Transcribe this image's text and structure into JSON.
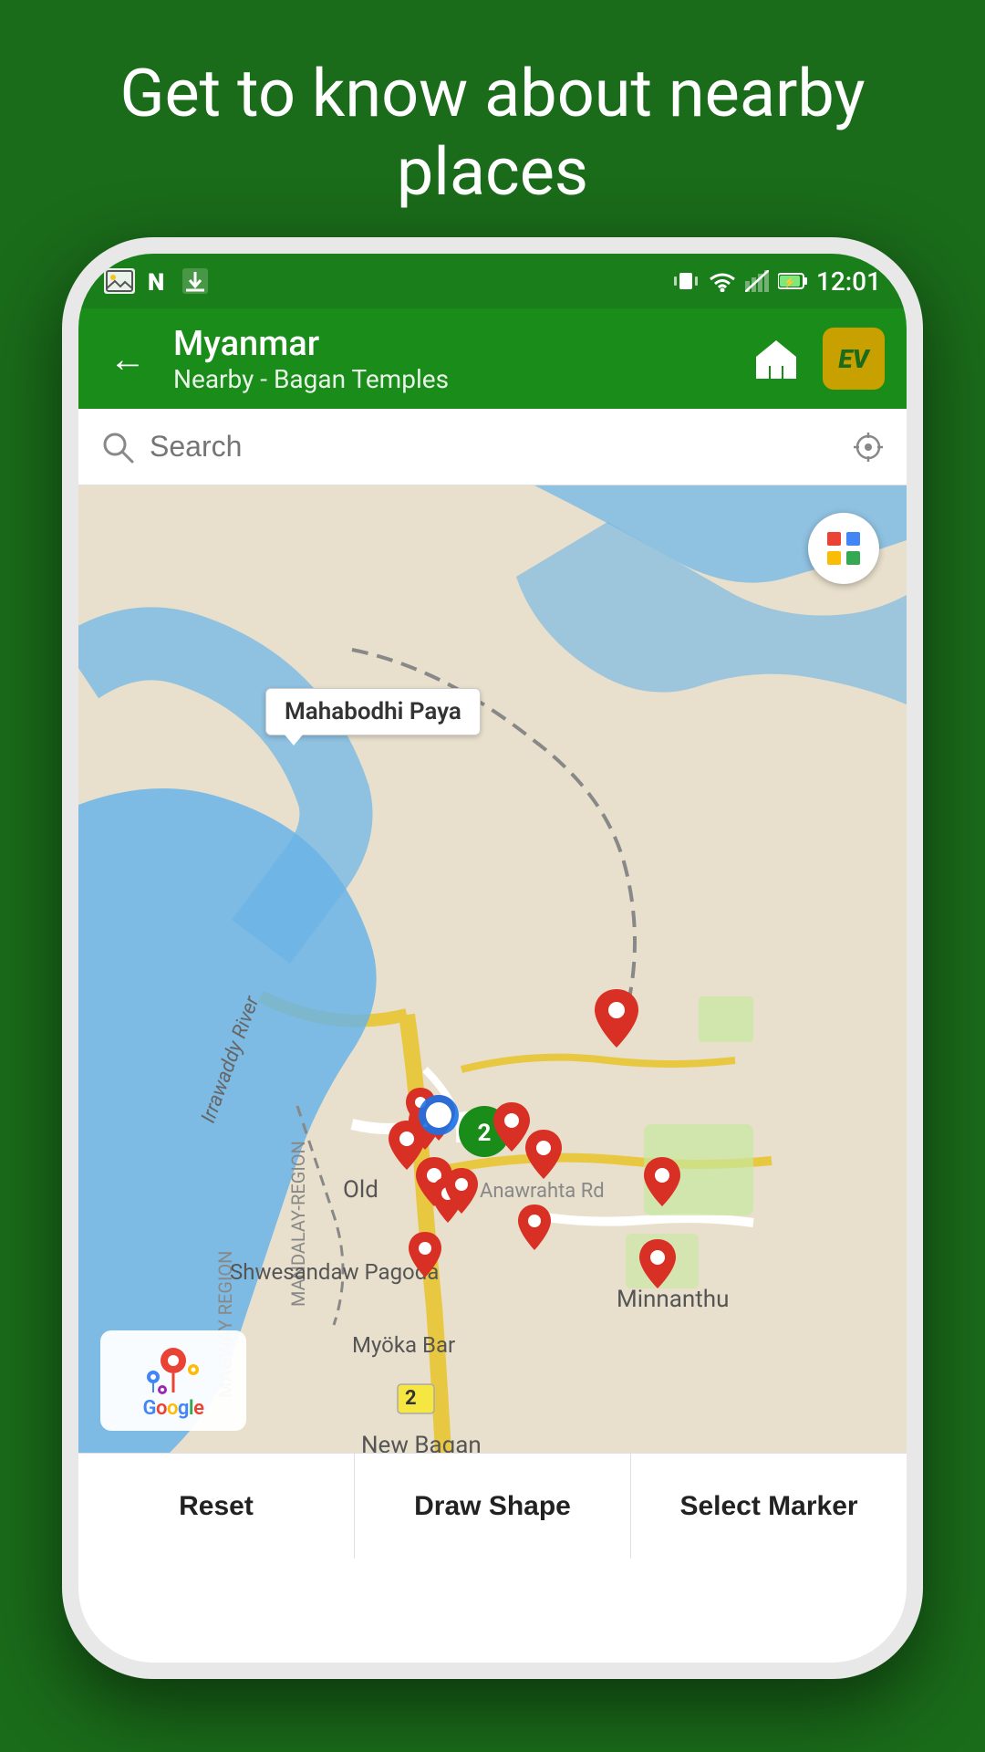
{
  "headline": "Get to know about nearby places",
  "status_bar": {
    "time": "12:01",
    "icons": [
      "image",
      "N",
      "download"
    ]
  },
  "toolbar": {
    "title": "Myanmar",
    "subtitle": "Nearby - Bagan Temples",
    "back_label": "←",
    "ev_label": "EV"
  },
  "search": {
    "placeholder": "Search"
  },
  "map": {
    "popup_label": "Mahabodhi Paya",
    "cluster_label": "2",
    "road_badge": "2",
    "place_labels": [
      "Shwesandaw Pagoda",
      "Minnanthu",
      "Old",
      "Irrawaddy River",
      "Anawrahta Rd",
      "My ka Bar",
      "New Bagan",
      "Mandalay Region",
      "Magway Region"
    ]
  },
  "grid_colors": [
    "#EA4335",
    "#4285F4",
    "#FBBC05",
    "#34A853"
  ],
  "google_text": "Google",
  "bottom_bar": {
    "reset_label": "Reset",
    "draw_shape_label": "Draw Shape",
    "select_marker_label": "Select Marker"
  }
}
